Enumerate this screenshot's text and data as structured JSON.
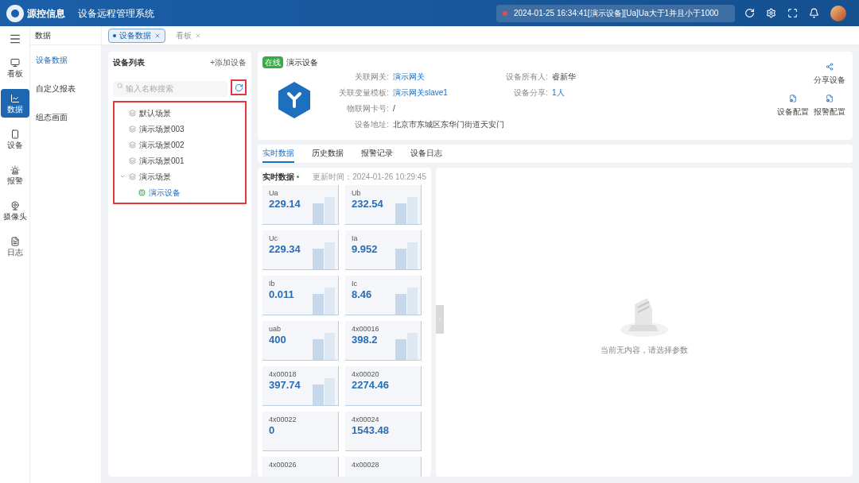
{
  "header": {
    "logo": "源控信息",
    "title": "设备远程管理系统",
    "alert": "2024-01-25 16:34:41[演示设备][Ua]Ua大于1并且小于1000"
  },
  "rail": [
    {
      "label": "看板",
      "selected": false
    },
    {
      "label": "数据",
      "selected": true
    },
    {
      "label": "设备",
      "selected": false
    },
    {
      "label": "报警",
      "selected": false
    },
    {
      "label": "摄像头",
      "selected": false
    },
    {
      "label": "日志",
      "selected": false
    }
  ],
  "submenu": {
    "title": "数据",
    "items": [
      {
        "label": "设备数据",
        "selected": true
      },
      {
        "label": "自定义报表",
        "selected": false
      },
      {
        "label": "组态画面",
        "selected": false
      }
    ]
  },
  "page_tabs": [
    {
      "label": "设备数据",
      "selected": true
    },
    {
      "label": "看板",
      "selected": false
    }
  ],
  "device_list": {
    "title": "设备列表",
    "add": "+添加设备",
    "search": {
      "placeholder": "输入名称搜索"
    },
    "refresh_highlighted": true,
    "tree_highlighted": true,
    "tree": [
      {
        "label": "默认场景",
        "selected": false
      },
      {
        "label": "演示场景003",
        "selected": false
      },
      {
        "label": "演示场景002",
        "selected": false
      },
      {
        "label": "演示场景001",
        "selected": false
      },
      {
        "label": "演示场景",
        "selected": false,
        "expanded": true,
        "children": [
          {
            "label": "演示设备",
            "selected": true
          }
        ]
      }
    ]
  },
  "device": {
    "status": "在线",
    "name": "演示设备",
    "fields": [
      [
        {
          "label": "关联网关:",
          "value": "演示网关",
          "link": true
        },
        {
          "label": "设备所有人:",
          "value": "睿新华",
          "link": false
        }
      ],
      [
        {
          "label": "关联变量模板:",
          "value": "演示网关slave1",
          "link": true
        },
        {
          "label": "设备分享:",
          "value": "1人",
          "link": true
        }
      ],
      [
        {
          "label": "物联网卡号:",
          "value": "/",
          "link": false
        }
      ],
      [
        {
          "label": "设备地址:",
          "value": "北京市东城区东华门街道天安门",
          "link": false
        }
      ]
    ],
    "actions": [
      {
        "label": "分享设备"
      },
      {
        "label": "设备配置"
      },
      {
        "label": "报警配置"
      }
    ]
  },
  "detail_tabs": [
    {
      "label": "实时数据",
      "selected": true
    },
    {
      "label": "历史数据",
      "selected": false
    },
    {
      "label": "报警记录",
      "selected": false
    },
    {
      "label": "设备日志",
      "selected": false
    }
  ],
  "realtime": {
    "title": "实时数据",
    "updated": "更新时间：2024-01-26 10:29:45",
    "cards": [
      {
        "name": "Ua",
        "value": "229.14",
        "kind": "bars"
      },
      {
        "name": "Ub",
        "value": "232.54",
        "kind": "bars"
      },
      {
        "name": "Uc",
        "value": "229.34",
        "kind": "bars"
      },
      {
        "name": "Ia",
        "value": "9.952",
        "kind": "bars"
      },
      {
        "name": "Ib",
        "value": "0.011",
        "kind": "bars"
      },
      {
        "name": "Ic",
        "value": "8.46",
        "kind": "bars"
      },
      {
        "name": "uab",
        "value": "400",
        "kind": "bars"
      },
      {
        "name": "4x00016",
        "value": "398.2",
        "kind": "bars"
      },
      {
        "name": "4x00018",
        "value": "397.74",
        "kind": "bars"
      },
      {
        "name": "4x00020",
        "value": "2274.46",
        "kind": "plain"
      },
      {
        "name": "4x00022",
        "value": "0",
        "kind": "plain"
      },
      {
        "name": "4x00024",
        "value": "1543.48",
        "kind": "plain"
      },
      {
        "name": "4x00026",
        "kind": "plain"
      },
      {
        "name": "4x00028",
        "kind": "plain"
      }
    ]
  },
  "empty_state": {
    "message": "当前无内容，请选择参数"
  }
}
